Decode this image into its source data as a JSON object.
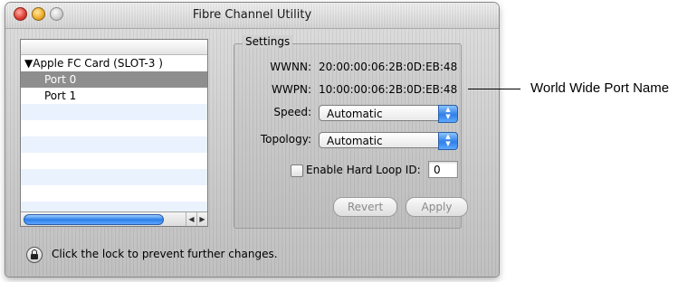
{
  "window": {
    "title": "Fibre Channel Utility"
  },
  "sidebar": {
    "items": [
      {
        "label": "▼Apple FC Card (SLOT-3 )",
        "level": "parent",
        "selected": false
      },
      {
        "label": "Port 0",
        "level": "child",
        "selected": true
      },
      {
        "label": "Port 1",
        "level": "child",
        "selected": false
      }
    ]
  },
  "settings": {
    "group_title": "Settings",
    "wwnn_label": "WWNN:",
    "wwnn_value": "20:00:00:06:2B:0D:EB:48",
    "wwpn_label": "WWPN:",
    "wwpn_value": "10:00:00:06:2B:0D:EB:48",
    "speed_label": "Speed:",
    "speed_value": "Automatic",
    "topology_label": "Topology:",
    "topology_value": "Automatic",
    "hard_loop_label": "Enable Hard Loop ID:",
    "hard_loop_checked": false,
    "hard_loop_value": "0",
    "revert_label": "Revert",
    "apply_label": "Apply"
  },
  "footer": {
    "lock_text": "Click the lock to prevent further changes."
  },
  "annotation": {
    "callout": "World Wide Port Name"
  }
}
